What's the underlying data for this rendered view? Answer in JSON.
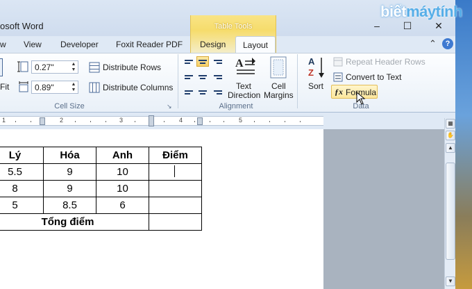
{
  "window": {
    "title": "osoft Word",
    "context_group": "Table Tools",
    "minimize": "–",
    "maximize": "☐",
    "close": "✕"
  },
  "tabs": [
    {
      "label": "w"
    },
    {
      "label": "View"
    },
    {
      "label": "Developer"
    },
    {
      "label": "Foxit Reader PDF"
    },
    {
      "label": "Design"
    },
    {
      "label": "Layout",
      "active": true
    }
  ],
  "ribbon": {
    "cell_size": {
      "fit_label": "Fit",
      "height_value": "0.27\"",
      "width_value": "0.89\"",
      "distribute_rows": "Distribute Rows",
      "distribute_columns": "Distribute Columns",
      "group_label": "Cell Size",
      "dialog_launcher": "↘"
    },
    "alignment": {
      "text_direction_line1": "Text",
      "text_direction_line2": "Direction",
      "cell_margins_line1": "Cell",
      "cell_margins_line2": "Margins",
      "group_label": "Alignment"
    },
    "data": {
      "sort": "Sort",
      "repeat_header_rows": "Repeat Header Rows",
      "convert_to_text": "Convert to Text",
      "formula": "Formula",
      "group_label": "Data"
    }
  },
  "ruler": {
    "numbers": [
      "1",
      "2",
      "3",
      "4",
      "5"
    ]
  },
  "table": {
    "headers": [
      "Lý",
      "Hóa",
      "Anh",
      "Điểm"
    ],
    "rows": [
      [
        "5.5",
        "9",
        "10",
        ""
      ],
      [
        "8",
        "9",
        "10",
        ""
      ],
      [
        "5",
        "8.5",
        "6",
        ""
      ]
    ],
    "total_label": "Tổng điểm",
    "total_value": ""
  },
  "watermark": {
    "part1": "biết",
    "part2": "máytính"
  }
}
